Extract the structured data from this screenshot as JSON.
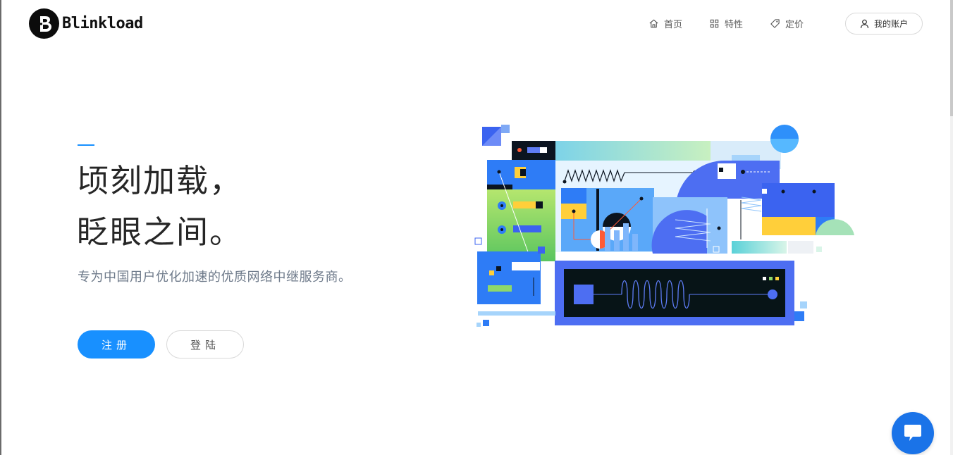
{
  "header": {
    "logo_text": "Blinkload",
    "nav": [
      {
        "label": "首页",
        "icon": "home-icon"
      },
      {
        "label": "特性",
        "icon": "grid-icon"
      },
      {
        "label": "定价",
        "icon": "tag-icon"
      }
    ],
    "account_label": "我的账户",
    "account_icon": "user-icon"
  },
  "hero": {
    "line1": "顷刻加载，",
    "line2": "眨眼之间。",
    "subtitle": "专为中国用户优化加速的优质网络中继服务商。",
    "register_label": "注册",
    "login_label": "登陆"
  },
  "chat": {
    "icon": "chat-bubble-icon"
  },
  "colors": {
    "accent": "#1890ff",
    "chat": "#1a73e8",
    "text_dark": "#262626",
    "text_muted": "#6e7a8a"
  }
}
